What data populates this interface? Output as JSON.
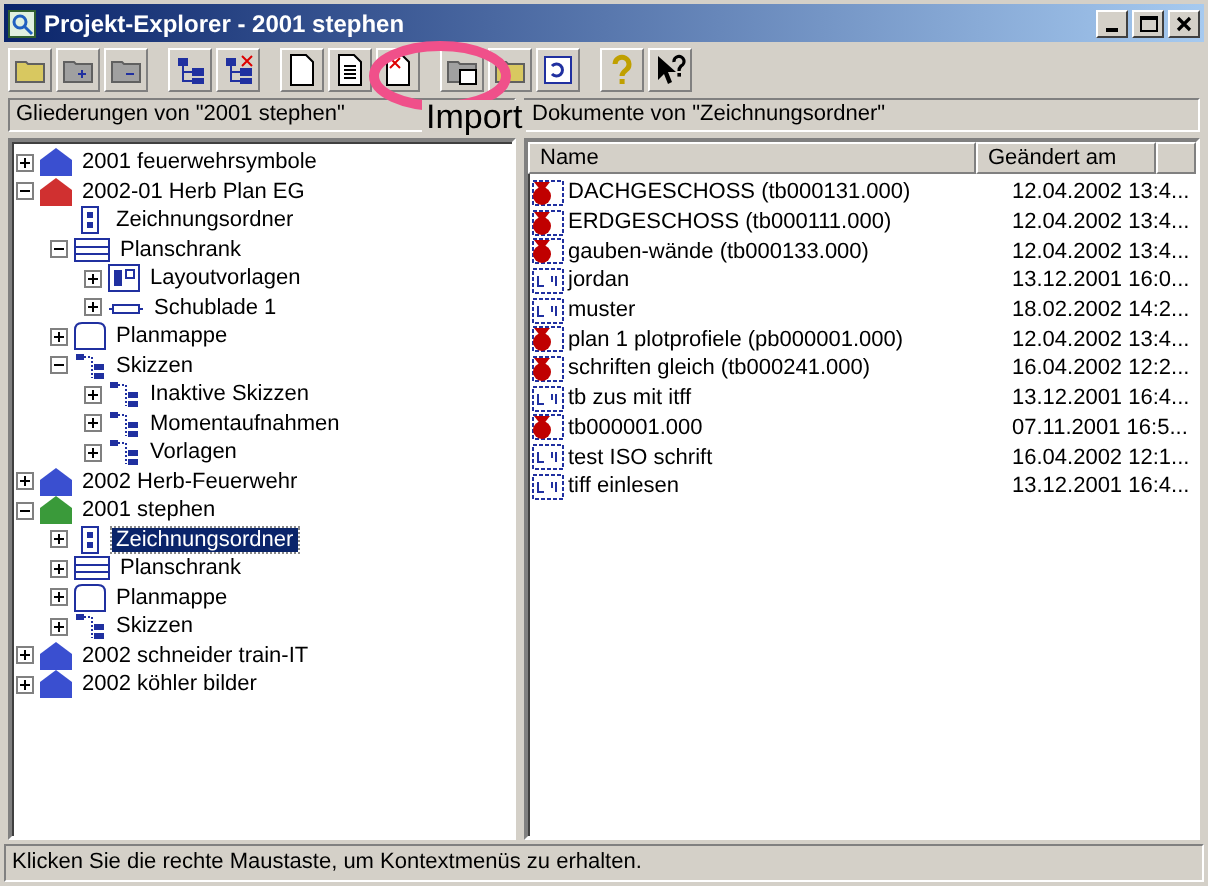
{
  "window": {
    "title": "Projekt-Explorer - 2001 stephen"
  },
  "annotation": {
    "text": "Import"
  },
  "left_pane": {
    "header": "Gliederungen von \"2001 stephen\"",
    "tree": [
      {
        "label": "2001 feuerwehrsymbole",
        "kind": "project",
        "color": "#3a4fd0",
        "expanded": false,
        "selected": false
      },
      {
        "label": "2002-01 Herb  Plan EG",
        "kind": "project",
        "color": "#d03030",
        "expanded": true,
        "selected": false,
        "children": [
          {
            "label": "Zeichnungsordner",
            "kind": "binder",
            "selected": false
          },
          {
            "label": "Planschrank",
            "kind": "cabinet",
            "expanded": true,
            "selected": false,
            "children": [
              {
                "label": "Layoutvorlagen",
                "kind": "layout",
                "expanded": false,
                "selected": false
              },
              {
                "label": "Schublade 1",
                "kind": "drawer",
                "expanded": false,
                "selected": false
              }
            ]
          },
          {
            "label": "Planmappe",
            "kind": "portfolio",
            "expanded": false,
            "selected": false
          },
          {
            "label": "Skizzen",
            "kind": "sketches",
            "expanded": true,
            "selected": false,
            "children": [
              {
                "label": "Inaktive Skizzen",
                "kind": "sketches",
                "expanded": false,
                "selected": false
              },
              {
                "label": "Momentaufnahmen",
                "kind": "sketches",
                "expanded": false,
                "selected": false
              },
              {
                "label": "Vorlagen",
                "kind": "sketches",
                "expanded": false,
                "selected": false
              }
            ]
          }
        ]
      },
      {
        "label": "2002 Herb-Feuerwehr",
        "kind": "project",
        "color": "#3a4fd0",
        "expanded": false,
        "selected": false
      },
      {
        "label": "2001 stephen",
        "kind": "project",
        "color": "#3a9a3a",
        "expanded": true,
        "selected": false,
        "children": [
          {
            "label": "Zeichnungsordner",
            "kind": "binder",
            "expanded": false,
            "selected": true
          },
          {
            "label": "Planschrank",
            "kind": "cabinet",
            "expanded": false,
            "selected": false
          },
          {
            "label": "Planmappe",
            "kind": "portfolio",
            "expanded": false,
            "selected": false
          },
          {
            "label": "Skizzen",
            "kind": "sketches",
            "expanded": false,
            "selected": false
          }
        ]
      },
      {
        "label": "2002 schneider train-IT",
        "kind": "project",
        "color": "#3a4fd0",
        "expanded": false,
        "selected": false
      },
      {
        "label": "2002 köhler bilder",
        "kind": "project",
        "color": "#3a4fd0",
        "expanded": false,
        "selected": false
      }
    ]
  },
  "right_pane": {
    "header": "Dokumente von \"Zeichnungsordner\"",
    "columns": [
      "Name",
      "Geändert am"
    ],
    "files": [
      {
        "name": "DACHGESCHOSS (tb000131.000)",
        "modified": "12.04.2002  13:4...",
        "kind": "drawing"
      },
      {
        "name": "ERDGESCHOSS (tb000111.000)",
        "modified": "12.04.2002  13:4...",
        "kind": "drawing"
      },
      {
        "name": "gauben-wände (tb000133.000)",
        "modified": "12.04.2002  13:4...",
        "kind": "drawing"
      },
      {
        "name": "jordan",
        "modified": "13.12.2001  16:0...",
        "kind": "sketch"
      },
      {
        "name": "muster",
        "modified": "18.02.2002  14:2...",
        "kind": "sketch"
      },
      {
        "name": "plan 1 plotprofiele (pb000001.000)",
        "modified": "12.04.2002  13:4...",
        "kind": "drawing"
      },
      {
        "name": "schriften gleich (tb000241.000)",
        "modified": "16.04.2002  12:2...",
        "kind": "drawing"
      },
      {
        "name": "tb zus mit itff",
        "modified": "13.12.2001  16:4...",
        "kind": "sketch"
      },
      {
        "name": "tb000001.000",
        "modified": "07.11.2001  16:5...",
        "kind": "drawing"
      },
      {
        "name": "test ISO schrift",
        "modified": "16.04.2002  12:1...",
        "kind": "sketch"
      },
      {
        "name": "tiff einlesen",
        "modified": "13.12.2001  16:4...",
        "kind": "sketch"
      }
    ]
  },
  "status_bar": {
    "text": "Klicken Sie die rechte Maustaste, um Kontextmenüs zu erhalten."
  }
}
